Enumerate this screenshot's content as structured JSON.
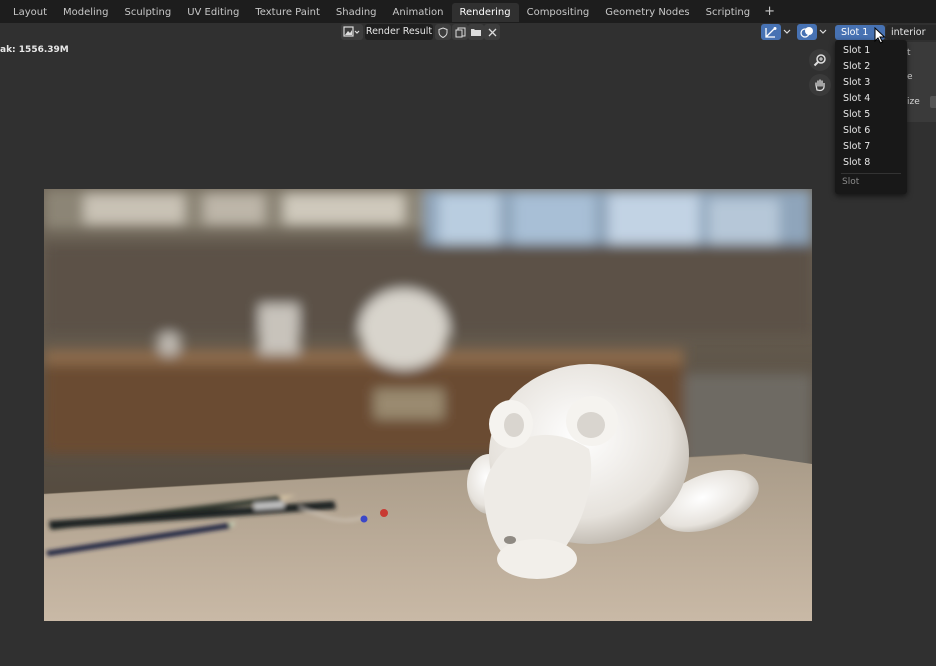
{
  "workspace_tabs": [
    "Layout",
    "Modeling",
    "Sculpting",
    "UV Editing",
    "Texture Paint",
    "Shading",
    "Animation",
    "Rendering",
    "Compositing",
    "Geometry Nodes",
    "Scripting"
  ],
  "active_tab": "Rendering",
  "add_tab_label": "+",
  "header": {
    "image_name": "Render Result",
    "slot_selected": "Slot 1",
    "layer_selected": "interior"
  },
  "stats_text": "ak: 1556.39M",
  "slot_menu": {
    "items": [
      "Slot 1",
      "Slot 2",
      "Slot 3",
      "Slot 4",
      "Slot 5",
      "Slot 6",
      "Slot 7",
      "Slot 8"
    ],
    "title": "Slot"
  },
  "sidebar_fragments": [
    "t",
    "e",
    "ize"
  ],
  "icons": {
    "image_type": "image-icon",
    "fake_user": "shield-icon",
    "duplicate": "copy-icon",
    "open": "folder-icon",
    "unlink": "close-icon",
    "gizmo": "gizmo-icon",
    "overlay": "overlay-icon",
    "zoom": "zoom-icon",
    "pan": "hand-icon"
  },
  "colors": {
    "accent": "#4772b3",
    "tabbar_bg": "#1d1d1d",
    "editor_bg": "#303030"
  }
}
